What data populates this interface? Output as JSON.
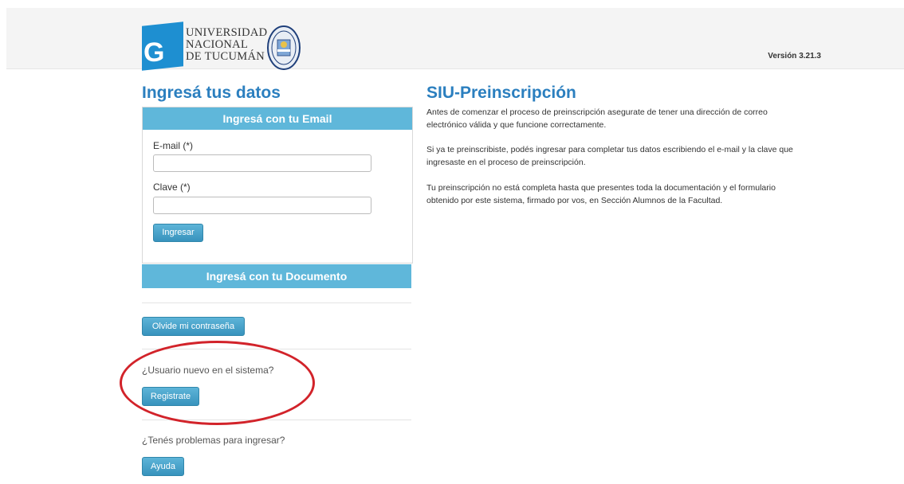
{
  "header": {
    "logo_lines": [
      "UNIVERSIDAD",
      "NACIONAL",
      "DE TUCUMÁN"
    ],
    "logo_letter": "G",
    "version": "Versión 3.21.3",
    "brand_color": "#1e8fd1"
  },
  "login": {
    "title": "Ingresá tus datos",
    "email_panel_title": "Ingresá con tu Email",
    "email_label": "E-mail (*)",
    "email_value": "",
    "password_label": "Clave (*)",
    "password_value": "",
    "submit_label": "Ingresar",
    "document_panel_title": "Ingresá con tu Documento",
    "forgot_label": "Olvide mi contraseña",
    "new_user_question": "¿Usuario nuevo en el sistema?",
    "register_label": "Registrate",
    "help_question": "¿Tenés problemas para ingresar?",
    "help_label": "Ayuda"
  },
  "info": {
    "title": "SIU-Preinscripción",
    "paragraphs": [
      "Antes de comenzar el proceso de preinscripción asegurate de tener una dirección de correo electrónico válida y que funcione correctamente.",
      "Si ya te preinscribiste, podés ingresar para completar tus datos escribiendo el e-mail y la clave que ingresaste en el proceso de preinscripción.",
      "Tu preinscripción no está completa hasta que presentes toda la documentación y el formulario obtenido por este sistema, firmado por vos, en Sección Alumnos de la Facultad."
    ]
  },
  "colors": {
    "accent": "#2b7fbf",
    "panel_header": "#5fb7da",
    "button": "#3a9bc4",
    "annotation": "#d2232a"
  }
}
